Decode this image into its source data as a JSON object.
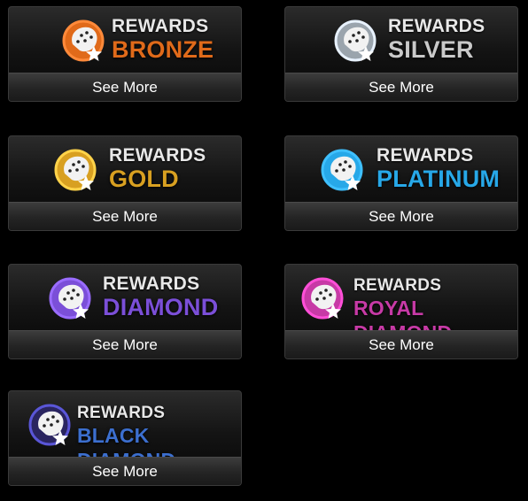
{
  "cards": [
    {
      "heading": "REWARDS",
      "tier": "BRONZE",
      "button": "See More",
      "color": "#e06a1a",
      "accent": "#ff8a3a",
      "icon": "cheetah-star-icon"
    },
    {
      "heading": "REWARDS",
      "tier": "SILVER",
      "button": "See More",
      "color": "#c9c9c9",
      "accent": "#e8f2ff",
      "icon": "cheetah-star-icon"
    },
    {
      "heading": "REWARDS",
      "tier": "GOLD",
      "button": "See More",
      "color": "#d8a021",
      "accent": "#ffd34a",
      "icon": "cheetah-star-icon"
    },
    {
      "heading": "REWARDS",
      "tier": "PLATINUM",
      "button": "See More",
      "color": "#27a8e8",
      "accent": "#3fc0ff",
      "icon": "cheetah-star-icon"
    },
    {
      "heading": "REWARDS",
      "tier": "DIAMOND",
      "button": "See More",
      "color": "#7b4fd8",
      "accent": "#9a6cff",
      "icon": "cheetah-star-icon"
    },
    {
      "heading": "REWARDS",
      "tier": "ROYAL DIAMOND",
      "button": "See More",
      "color": "#c73aa6",
      "accent": "#ff4fd8",
      "icon": "cheetah-star-icon"
    },
    {
      "heading": "REWARDS",
      "tier": "BLACK DIAMOND",
      "button": "See More",
      "color": "#3c6fcf",
      "accent": "#5a56d8",
      "icon": "cheetah-star-icon"
    }
  ]
}
